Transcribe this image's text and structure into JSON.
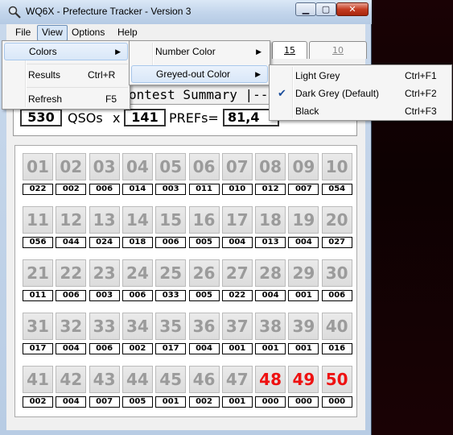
{
  "window": {
    "title": "WQ6X - Prefecture Tracker - Version 3",
    "min_glyph": "▁",
    "max_glyph": "▢",
    "close_glyph": "✕"
  },
  "menubar": {
    "file": "File",
    "view": "View",
    "options": "Options",
    "help": "Help"
  },
  "view_menu": {
    "colors": "Colors",
    "results": "Results",
    "results_shortcut": "Ctrl+R",
    "refresh": "Refresh",
    "refresh_shortcut": "F5"
  },
  "colors_menu": {
    "number_color": "Number Color",
    "greyed_out_color": "Greyed-out Color"
  },
  "greyed_menu": {
    "items": [
      {
        "label": "Light Grey",
        "shortcut": "Ctrl+F1",
        "checked": false
      },
      {
        "label": "Dark Grey (Default)",
        "shortcut": "Ctrl+F2",
        "checked": true
      },
      {
        "label": "Black",
        "shortcut": "Ctrl+F3",
        "checked": false
      }
    ],
    "check_glyph": "✔"
  },
  "tabs": {
    "t15": "15",
    "t10": "10"
  },
  "summary": {
    "title": "ontest Summary |---",
    "qsos": "530",
    "qsos_label": "QSOs",
    "x_label": "x",
    "mult": "141",
    "prefs_label": "PREFs=",
    "score": "81,4"
  },
  "colors": {
    "greyed": "#9b9b9b",
    "number_red": "#ee1111"
  },
  "prefectures": [
    {
      "n": "01",
      "c": "022",
      "red": false
    },
    {
      "n": "02",
      "c": "002",
      "red": false
    },
    {
      "n": "03",
      "c": "006",
      "red": false
    },
    {
      "n": "04",
      "c": "014",
      "red": false
    },
    {
      "n": "05",
      "c": "003",
      "red": false
    },
    {
      "n": "06",
      "c": "011",
      "red": false
    },
    {
      "n": "07",
      "c": "010",
      "red": false
    },
    {
      "n": "08",
      "c": "012",
      "red": false
    },
    {
      "n": "09",
      "c": "007",
      "red": false
    },
    {
      "n": "10",
      "c": "054",
      "red": false
    },
    {
      "n": "11",
      "c": "056",
      "red": false
    },
    {
      "n": "12",
      "c": "044",
      "red": false
    },
    {
      "n": "13",
      "c": "024",
      "red": false
    },
    {
      "n": "14",
      "c": "018",
      "red": false
    },
    {
      "n": "15",
      "c": "006",
      "red": false
    },
    {
      "n": "16",
      "c": "005",
      "red": false
    },
    {
      "n": "17",
      "c": "004",
      "red": false
    },
    {
      "n": "18",
      "c": "013",
      "red": false
    },
    {
      "n": "19",
      "c": "004",
      "red": false
    },
    {
      "n": "20",
      "c": "027",
      "red": false
    },
    {
      "n": "21",
      "c": "011",
      "red": false
    },
    {
      "n": "22",
      "c": "006",
      "red": false
    },
    {
      "n": "23",
      "c": "003",
      "red": false
    },
    {
      "n": "24",
      "c": "006",
      "red": false
    },
    {
      "n": "25",
      "c": "033",
      "red": false
    },
    {
      "n": "26",
      "c": "005",
      "red": false
    },
    {
      "n": "27",
      "c": "022",
      "red": false
    },
    {
      "n": "28",
      "c": "004",
      "red": false
    },
    {
      "n": "29",
      "c": "001",
      "red": false
    },
    {
      "n": "30",
      "c": "006",
      "red": false
    },
    {
      "n": "31",
      "c": "017",
      "red": false
    },
    {
      "n": "32",
      "c": "004",
      "red": false
    },
    {
      "n": "33",
      "c": "006",
      "red": false
    },
    {
      "n": "34",
      "c": "002",
      "red": false
    },
    {
      "n": "35",
      "c": "017",
      "red": false
    },
    {
      "n": "36",
      "c": "004",
      "red": false
    },
    {
      "n": "37",
      "c": "001",
      "red": false
    },
    {
      "n": "38",
      "c": "001",
      "red": false
    },
    {
      "n": "39",
      "c": "001",
      "red": false
    },
    {
      "n": "40",
      "c": "016",
      "red": false
    },
    {
      "n": "41",
      "c": "002",
      "red": false
    },
    {
      "n": "42",
      "c": "004",
      "red": false
    },
    {
      "n": "43",
      "c": "007",
      "red": false
    },
    {
      "n": "44",
      "c": "005",
      "red": false
    },
    {
      "n": "45",
      "c": "001",
      "red": false
    },
    {
      "n": "46",
      "c": "002",
      "red": false
    },
    {
      "n": "47",
      "c": "001",
      "red": false
    },
    {
      "n": "48",
      "c": "000",
      "red": true
    },
    {
      "n": "49",
      "c": "000",
      "red": true
    },
    {
      "n": "50",
      "c": "000",
      "red": true
    }
  ]
}
